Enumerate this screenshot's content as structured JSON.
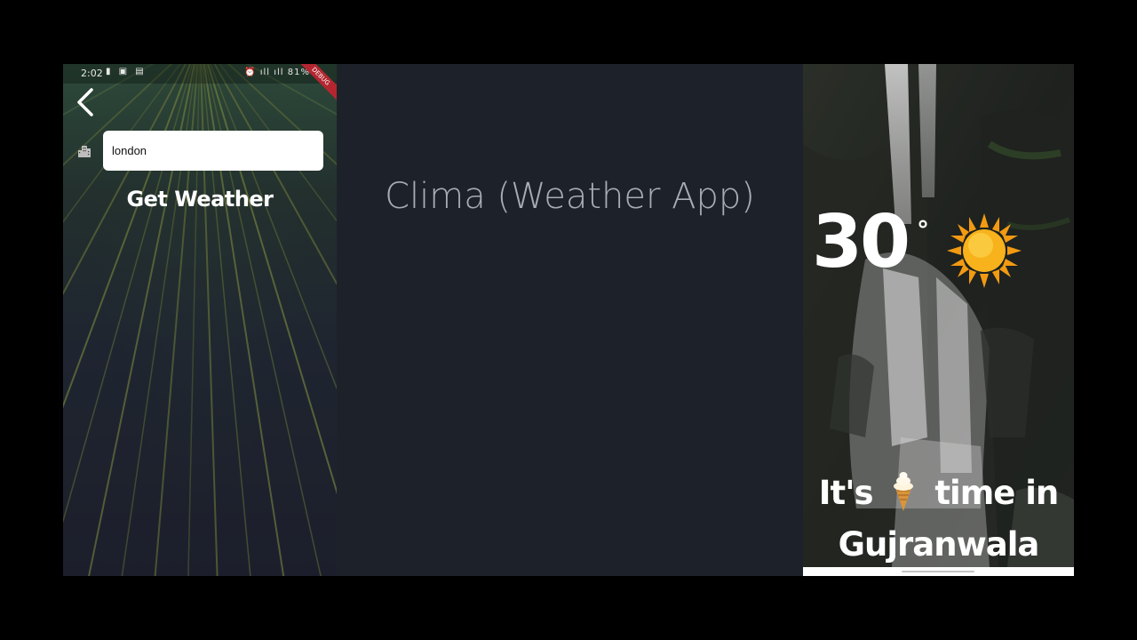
{
  "presentation": {
    "title": "Clima (Weather App)"
  },
  "city_screen": {
    "status_bar": {
      "time": "2:02",
      "battery": "81%",
      "debug_banner": "DEBUG"
    },
    "back_icon": "back-arrow-icon",
    "city_icon": "location-city-icon",
    "city_input": {
      "value": "london"
    },
    "get_weather_label": "Get Weather"
  },
  "location_screen": {
    "temperature": "30",
    "degree_symbol": "°",
    "condition_icon": "sun-icon",
    "message_prefix": "It's",
    "message_icon": "ice-cream-icon",
    "message_suffix": "time in",
    "city": "Gujranwala"
  },
  "colors": {
    "background": "#000000",
    "slide": "#1d222a",
    "title": "#a7adb6",
    "text_white": "#ffffff",
    "debug_ribbon": "#b32630"
  }
}
